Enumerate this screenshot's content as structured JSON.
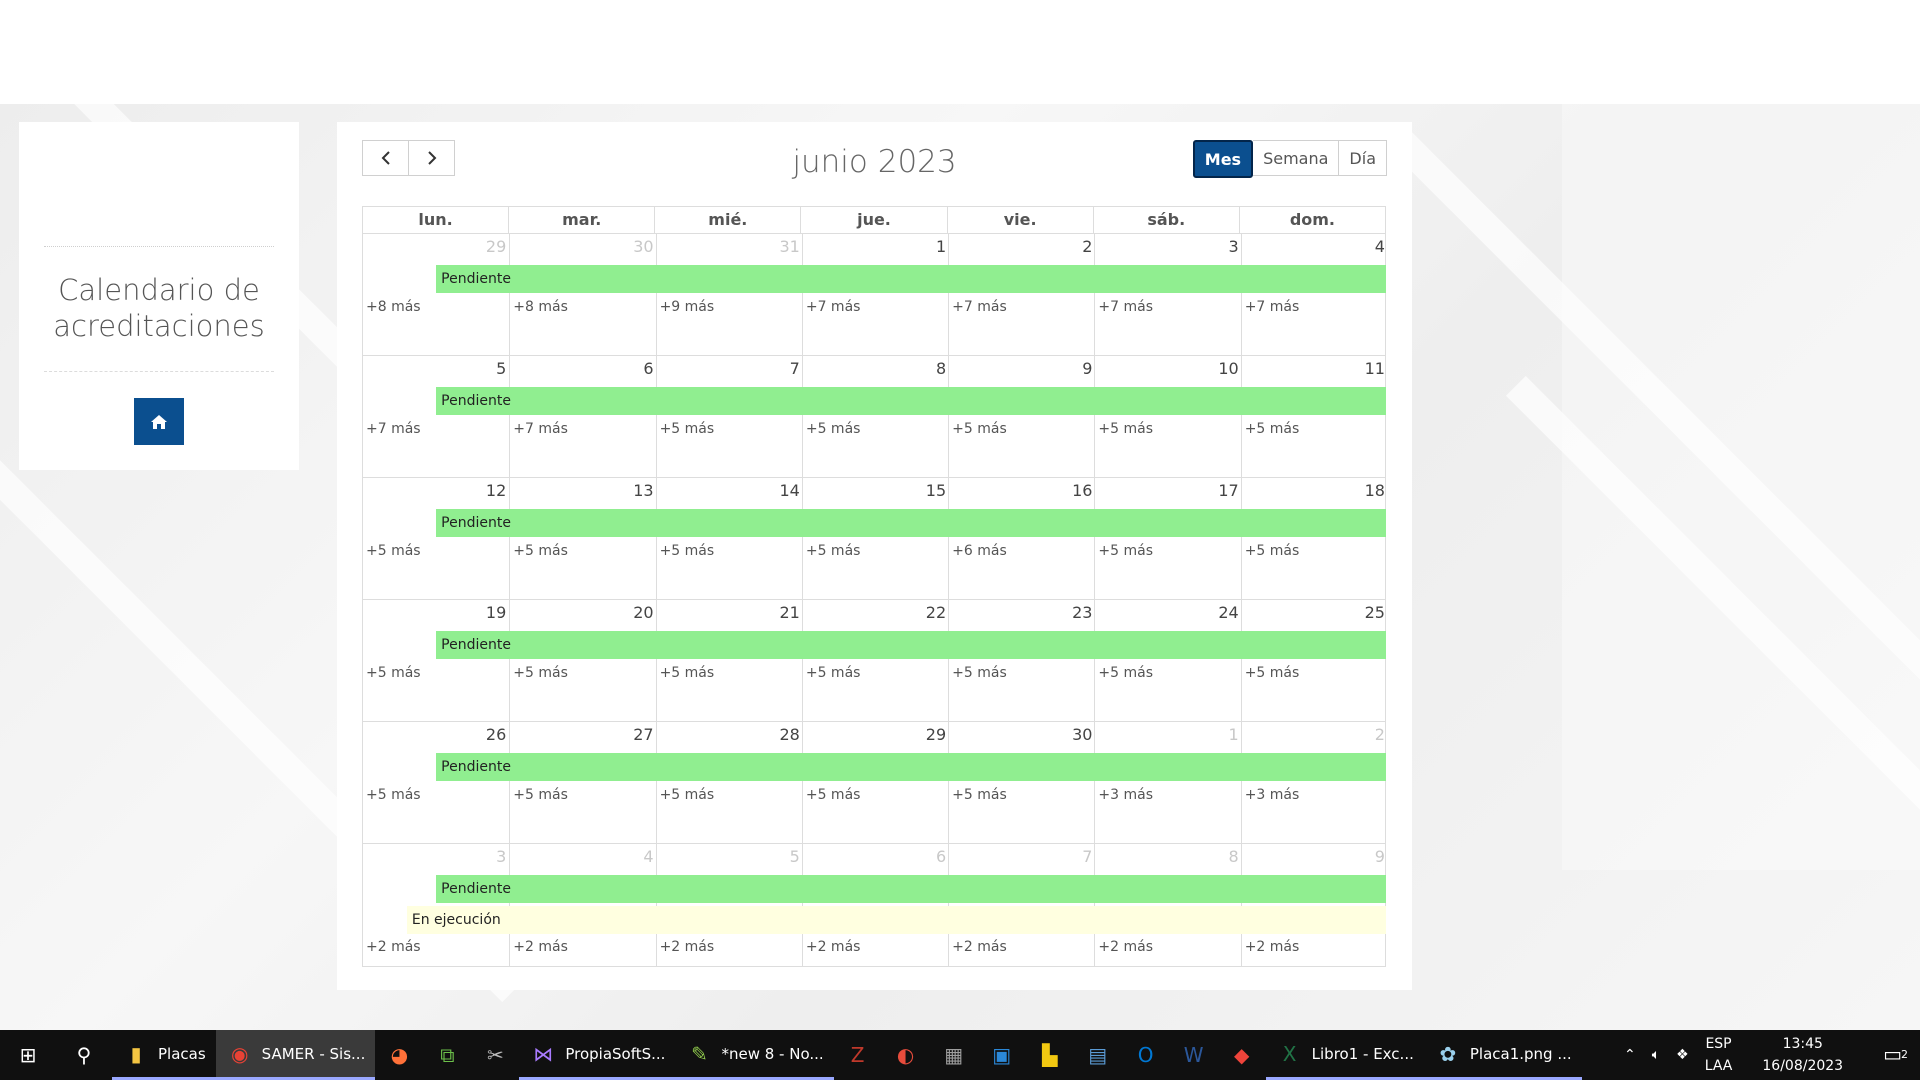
{
  "sidebar": {
    "title": "Calendario de acreditaciones",
    "home_icon": "home-icon"
  },
  "calendar": {
    "title": "junio 2023",
    "prev_icon": "chevron-left-icon",
    "next_icon": "chevron-right-icon",
    "views": [
      "Mes",
      "Semana",
      "Día"
    ],
    "active_view": "Mes",
    "weekdays": [
      "lun.",
      "mar.",
      "mié.",
      "jue.",
      "vie.",
      "sáb.",
      "dom."
    ],
    "weeks": [
      {
        "days": [
          {
            "n": "29",
            "other": true
          },
          {
            "n": "30",
            "other": true
          },
          {
            "n": "31",
            "other": true
          },
          {
            "n": "1"
          },
          {
            "n": "2"
          },
          {
            "n": "3"
          },
          {
            "n": "4"
          }
        ],
        "events": [
          {
            "label": "Pendiente",
            "color": "#90ee90",
            "start_col": 0.5
          }
        ],
        "more": [
          "+8 más",
          "+8 más",
          "+9 más",
          "+7 más",
          "+7 más",
          "+7 más",
          "+7 más"
        ]
      },
      {
        "days": [
          {
            "n": "5"
          },
          {
            "n": "6"
          },
          {
            "n": "7"
          },
          {
            "n": "8"
          },
          {
            "n": "9"
          },
          {
            "n": "10"
          },
          {
            "n": "11"
          }
        ],
        "events": [
          {
            "label": "Pendiente",
            "color": "#90ee90",
            "start_col": 0.5
          }
        ],
        "more": [
          "+7 más",
          "+7 más",
          "+5 más",
          "+5 más",
          "+5 más",
          "+5 más",
          "+5 más"
        ]
      },
      {
        "days": [
          {
            "n": "12"
          },
          {
            "n": "13"
          },
          {
            "n": "14"
          },
          {
            "n": "15"
          },
          {
            "n": "16"
          },
          {
            "n": "17"
          },
          {
            "n": "18"
          }
        ],
        "events": [
          {
            "label": "Pendiente",
            "color": "#90ee90",
            "start_col": 0.5
          }
        ],
        "more": [
          "+5 más",
          "+5 más",
          "+5 más",
          "+5 más",
          "+6 más",
          "+5 más",
          "+5 más"
        ]
      },
      {
        "days": [
          {
            "n": "19"
          },
          {
            "n": "20"
          },
          {
            "n": "21"
          },
          {
            "n": "22"
          },
          {
            "n": "23"
          },
          {
            "n": "24"
          },
          {
            "n": "25"
          }
        ],
        "events": [
          {
            "label": "Pendiente",
            "color": "#90ee90",
            "start_col": 0.5
          }
        ],
        "more": [
          "+5 más",
          "+5 más",
          "+5 más",
          "+5 más",
          "+5 más",
          "+5 más",
          "+5 más"
        ]
      },
      {
        "days": [
          {
            "n": "26"
          },
          {
            "n": "27"
          },
          {
            "n": "28"
          },
          {
            "n": "29"
          },
          {
            "n": "30"
          },
          {
            "n": "1",
            "other": true
          },
          {
            "n": "2",
            "other": true
          }
        ],
        "events": [
          {
            "label": "Pendiente",
            "color": "#90ee90",
            "start_col": 0.5
          }
        ],
        "more": [
          "+5 más",
          "+5 más",
          "+5 más",
          "+5 más",
          "+5 más",
          "+3 más",
          "+3 más"
        ]
      },
      {
        "days": [
          {
            "n": "3",
            "other": true
          },
          {
            "n": "4",
            "other": true
          },
          {
            "n": "5",
            "other": true
          },
          {
            "n": "6",
            "other": true
          },
          {
            "n": "7",
            "other": true
          },
          {
            "n": "8",
            "other": true
          },
          {
            "n": "9",
            "other": true
          }
        ],
        "events": [
          {
            "label": "Pendiente",
            "color": "#90ee90",
            "start_col": 0.5
          },
          {
            "label": "En ejecución",
            "color": "#ffffe0",
            "start_col": 0.3
          }
        ],
        "more": [
          "+2 más",
          "+2 más",
          "+2 más",
          "+2 más",
          "+2 más",
          "+2 más",
          "+2 más"
        ]
      }
    ]
  },
  "taskbar": {
    "items": [
      {
        "icon": "windows-start-icon",
        "glyph": "⊞",
        "label": ""
      },
      {
        "icon": "search-icon",
        "glyph": "⚲",
        "label": ""
      },
      {
        "icon": "folder-icon",
        "glyph": "▮",
        "label": "Placas",
        "color": "#f4c542"
      },
      {
        "icon": "chrome-icon",
        "glyph": "◉",
        "label": "SAMER - Sis...",
        "color": "#e94235",
        "active": true
      },
      {
        "icon": "firefox-icon",
        "glyph": "◕",
        "label": "",
        "color": "#ff7139"
      },
      {
        "icon": "network-tool-icon",
        "glyph": "⧉",
        "label": "",
        "color": "#6cc04a"
      },
      {
        "icon": "tools-icon",
        "glyph": "✂",
        "label": "",
        "color": "#bbbbbb"
      },
      {
        "icon": "visual-studio-icon",
        "glyph": "⋈",
        "label": "PropiaSoftS...",
        "color": "#a97bff"
      },
      {
        "icon": "notepadpp-icon",
        "glyph": "✎",
        "label": "*new 8 - No...",
        "color": "#8bc34a"
      },
      {
        "icon": "filezilla-icon",
        "glyph": "Z",
        "label": "",
        "color": "#c0392b"
      },
      {
        "icon": "ccleaner-icon",
        "glyph": "◐",
        "label": "",
        "color": "#e74c3c"
      },
      {
        "icon": "calculator-icon",
        "glyph": "▦",
        "label": "",
        "color": "#9e9e9e"
      },
      {
        "icon": "app-window-icon",
        "glyph": "▣",
        "label": "",
        "color": "#2b88d8"
      },
      {
        "icon": "power-bi-icon",
        "glyph": "▙",
        "label": "",
        "color": "#f2c811"
      },
      {
        "icon": "remote-desktop-icon",
        "glyph": "▤",
        "label": "",
        "color": "#5b9bd5"
      },
      {
        "icon": "outlook-icon",
        "glyph": "O",
        "label": "",
        "color": "#0078d4"
      },
      {
        "icon": "word-icon",
        "glyph": "W",
        "label": "",
        "color": "#2b579a"
      },
      {
        "icon": "anydesk-icon",
        "glyph": "◆",
        "label": "",
        "color": "#ef443b"
      },
      {
        "icon": "excel-icon",
        "glyph": "X",
        "label": "Libro1 - Exc...",
        "color": "#217346"
      },
      {
        "icon": "paint-icon",
        "glyph": "✿",
        "label": "Placa1.png ...",
        "color": "#9ad0ec"
      }
    ],
    "tray": {
      "chevron_icon": "chevron-up-icon",
      "volume_icon": "volume-icon",
      "dropbox_icon": "dropbox-icon",
      "lang_line1": "ESP",
      "lang_line2": "LAA",
      "time": "13:45",
      "date": "16/08/2023",
      "notification_icon": "notification-icon",
      "notification_count": "2"
    }
  }
}
